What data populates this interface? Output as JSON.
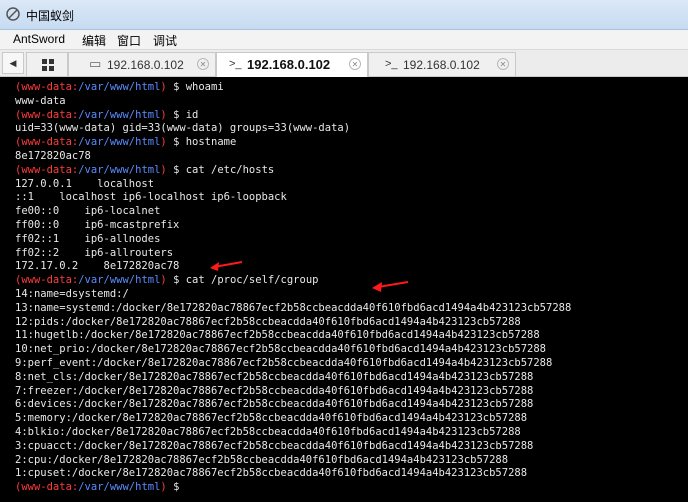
{
  "window": {
    "title": "中国蚁剑",
    "icon": "antsword-logo-icon"
  },
  "menu": {
    "items": [
      "AntSword",
      "编辑",
      "窗口",
      "调试"
    ]
  },
  "tabs": [
    {
      "label": "192.168.0.102",
      "icon": "folder-icon",
      "active": false
    },
    {
      "label": "192.168.0.102",
      "icon": "terminal-icon",
      "active": true
    },
    {
      "label": "192.168.0.102",
      "icon": "terminal-icon",
      "active": false
    }
  ],
  "tab_icon_glyphs": {
    "folder": "▭",
    "terminal": ">_",
    "close": "✕",
    "scroll_left": "◀"
  },
  "terminal": {
    "prompt": {
      "user": "www-data",
      "path": "/var/www/html",
      "symbol": "$"
    },
    "lines": [
      {
        "type": "prompt",
        "cmd": "whoami"
      },
      {
        "type": "out",
        "text": "www-data"
      },
      {
        "type": "prompt",
        "cmd": "id"
      },
      {
        "type": "out",
        "text": "uid=33(www-data) gid=33(www-data) groups=33(www-data)"
      },
      {
        "type": "prompt",
        "cmd": "hostname"
      },
      {
        "type": "out",
        "text": "8e172820ac78"
      },
      {
        "type": "prompt",
        "cmd": "cat /etc/hosts"
      },
      {
        "type": "out",
        "text": "127.0.0.1    localhost"
      },
      {
        "type": "out",
        "text": "::1    localhost ip6-localhost ip6-loopback"
      },
      {
        "type": "out",
        "text": "fe00::0    ip6-localnet"
      },
      {
        "type": "out",
        "text": "ff00::0    ip6-mcastprefix"
      },
      {
        "type": "out",
        "text": "ff02::1    ip6-allnodes"
      },
      {
        "type": "out",
        "text": "ff02::2    ip6-allrouters"
      },
      {
        "type": "out",
        "text": "172.17.0.2    8e172820ac78"
      },
      {
        "type": "prompt",
        "cmd": "cat /proc/self/cgroup"
      },
      {
        "type": "out",
        "text": "14:name=dsystemd:/"
      },
      {
        "type": "out",
        "text": "13:name=systemd:/docker/8e172820ac78867ecf2b58ccbeacdda40f610fbd6acd1494a4b423123cb57288"
      },
      {
        "type": "out",
        "text": "12:pids:/docker/8e172820ac78867ecf2b58ccbeacdda40f610fbd6acd1494a4b423123cb57288"
      },
      {
        "type": "out",
        "text": "11:hugetlb:/docker/8e172820ac78867ecf2b58ccbeacdda40f610fbd6acd1494a4b423123cb57288"
      },
      {
        "type": "out",
        "text": "10:net_prio:/docker/8e172820ac78867ecf2b58ccbeacdda40f610fbd6acd1494a4b423123cb57288"
      },
      {
        "type": "out",
        "text": "9:perf_event:/docker/8e172820ac78867ecf2b58ccbeacdda40f610fbd6acd1494a4b423123cb57288"
      },
      {
        "type": "out",
        "text": "8:net_cls:/docker/8e172820ac78867ecf2b58ccbeacdda40f610fbd6acd1494a4b423123cb57288"
      },
      {
        "type": "out",
        "text": "7:freezer:/docker/8e172820ac78867ecf2b58ccbeacdda40f610fbd6acd1494a4b423123cb57288"
      },
      {
        "type": "out",
        "text": "6:devices:/docker/8e172820ac78867ecf2b58ccbeacdda40f610fbd6acd1494a4b423123cb57288"
      },
      {
        "type": "out",
        "text": "5:memory:/docker/8e172820ac78867ecf2b58ccbeacdda40f610fbd6acd1494a4b423123cb57288"
      },
      {
        "type": "out",
        "text": "4:blkio:/docker/8e172820ac78867ecf2b58ccbeacdda40f610fbd6acd1494a4b423123cb57288"
      },
      {
        "type": "out",
        "text": "3:cpuacct:/docker/8e172820ac78867ecf2b58ccbeacdda40f610fbd6acd1494a4b423123cb57288"
      },
      {
        "type": "out",
        "text": "2:cpu:/docker/8e172820ac78867ecf2b58ccbeacdda40f610fbd6acd1494a4b423123cb57288"
      },
      {
        "type": "out",
        "text": "1:cpuset:/docker/8e172820ac78867ecf2b58ccbeacdda40f610fbd6acd1494a4b423123cb57288"
      },
      {
        "type": "prompt",
        "cmd": ""
      }
    ]
  },
  "annotations": {
    "arrow_color": "#ff1a1a"
  },
  "colors": {
    "terminal_bg": "#000000",
    "terminal_fg": "#e8e8e8",
    "prompt_user": "#ff3b3b",
    "prompt_path": "#5a8cff"
  }
}
